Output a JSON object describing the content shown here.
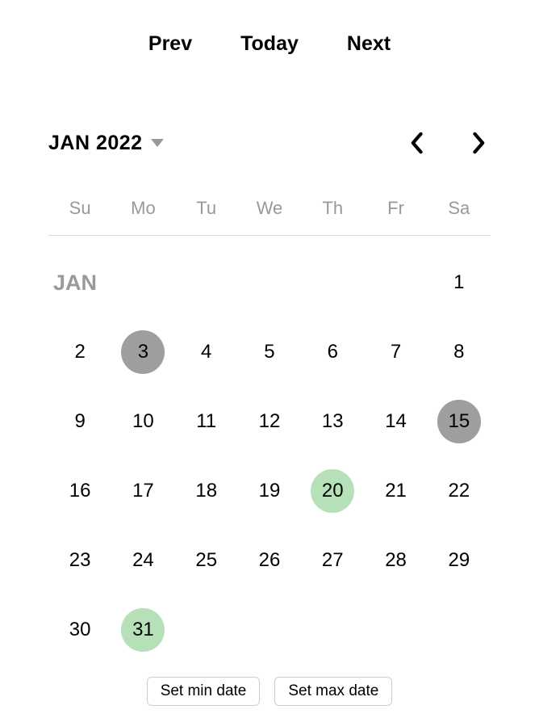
{
  "nav": {
    "prev_label": "Prev",
    "today_label": "Today",
    "next_label": "Next"
  },
  "header": {
    "month_year": "JAN 2022"
  },
  "weekdays": [
    "Su",
    "Mo",
    "Tu",
    "We",
    "Th",
    "Fr",
    "Sa"
  ],
  "month_name": "JAN",
  "first_day": "1",
  "days": [
    {
      "n": "2",
      "state": ""
    },
    {
      "n": "3",
      "state": "selected"
    },
    {
      "n": "4",
      "state": ""
    },
    {
      "n": "5",
      "state": ""
    },
    {
      "n": "6",
      "state": ""
    },
    {
      "n": "7",
      "state": ""
    },
    {
      "n": "8",
      "state": ""
    },
    {
      "n": "9",
      "state": ""
    },
    {
      "n": "10",
      "state": ""
    },
    {
      "n": "11",
      "state": ""
    },
    {
      "n": "12",
      "state": ""
    },
    {
      "n": "13",
      "state": ""
    },
    {
      "n": "14",
      "state": ""
    },
    {
      "n": "15",
      "state": "selected"
    },
    {
      "n": "16",
      "state": ""
    },
    {
      "n": "17",
      "state": ""
    },
    {
      "n": "18",
      "state": ""
    },
    {
      "n": "19",
      "state": ""
    },
    {
      "n": "20",
      "state": "highlighted"
    },
    {
      "n": "21",
      "state": ""
    },
    {
      "n": "22",
      "state": ""
    },
    {
      "n": "23",
      "state": ""
    },
    {
      "n": "24",
      "state": ""
    },
    {
      "n": "25",
      "state": ""
    },
    {
      "n": "26",
      "state": ""
    },
    {
      "n": "27",
      "state": ""
    },
    {
      "n": "28",
      "state": ""
    },
    {
      "n": "29",
      "state": ""
    },
    {
      "n": "30",
      "state": ""
    },
    {
      "n": "31",
      "state": "highlighted"
    }
  ],
  "buttons": {
    "min_label": "Set min date",
    "max_label": "Set max date"
  }
}
